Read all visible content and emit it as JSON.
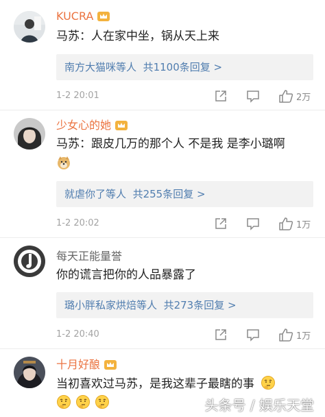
{
  "comments": [
    {
      "username": "KUCRA",
      "text": "马苏：人在家中坐，锅从天上来",
      "reply_users": "南方大猫咪等人",
      "reply_count": "共1100条回复 >",
      "time": "1-2 20:01",
      "likes": "2万"
    },
    {
      "username": "少女心的她",
      "text": "马苏：跟皮几万的那个人 不是我 是李小璐啊",
      "reply_users": "就虐你了等人",
      "reply_count": "共255条回复 >",
      "time": "1-2 20:02",
      "likes": "1万"
    },
    {
      "username": "每天正能量誉",
      "text": "你的谎言把你的人品暴露了",
      "reply_users": "璐小胖私家烘焙等人",
      "reply_count": "共273条回复 >",
      "time": "1-2 20:40",
      "likes": "1万"
    },
    {
      "username": "十月好酿",
      "text": "当初喜欢过马苏，是我这辈子最瞎的事"
    }
  ],
  "watermark": "头条号 / 娱乐天堂",
  "colors": {
    "vip_name": "#eb7340",
    "link_blue": "#507daf",
    "reply_bg": "#f2f2f2",
    "meta_gray": "#a3a3a3"
  },
  "icons": [
    "crown-badge-icon",
    "share-icon",
    "comment-icon",
    "like-icon",
    "doge-emoji-icon",
    "thinking-emoji-icon"
  ]
}
